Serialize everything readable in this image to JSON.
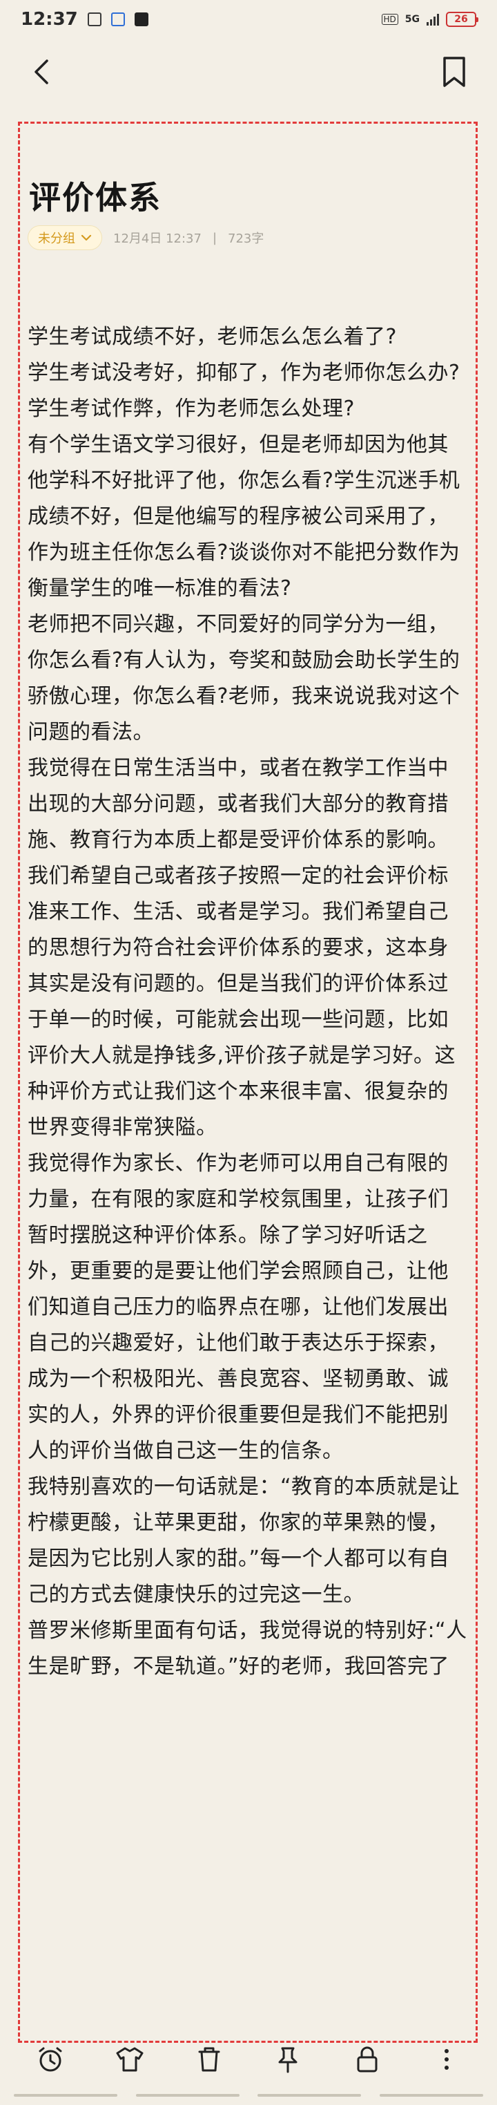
{
  "status_bar": {
    "time": "12:37",
    "network": "5G",
    "hd": "HD",
    "battery": "26",
    "battery_color": "#cc3333"
  },
  "nav": {
    "back_icon": "chevron-left-icon",
    "bookmark_icon": "bookmark-icon"
  },
  "note": {
    "title": "评价体系",
    "category": "未分组",
    "date": "12月4日 12:37",
    "separator": "|",
    "word_count": "723字",
    "paragraphs": [
      "学生考试成绩不好，老师怎么怎么着了?",
      "学生考试没考好，抑郁了，作为老师你怎么办?",
      "学生考试作弊，作为老师怎么处理?",
      "有个学生语文学习很好，但是老师却因为他其他学科不好批评了他，你怎么看?学生沉迷手机成绩不好，但是他编写的程序被公司采用了，作为班主任你怎么看?谈谈你对不能把分数作为衡量学生的唯一标准的看法?",
      "老师把不同兴趣，不同爱好的同学分为一组，你怎么看?有人认为，夸奖和鼓励会助长学生的骄傲心理，你怎么看?老师，我来说说我对这个问题的看法。",
      "我觉得在日常生活当中，或者在教学工作当中出现的大部分问题，或者我们大部分的教育措施、教育行为本质上都是受评价体系的影响。我们希望自己或者孩子按照一定的社会评价标准来工作、生活、或者是学习。我们希望自己的思想行为符合社会评价体系的要求，这本身其实是没有问题的。但是当我们的评价体系过于单一的时候，可能就会出现一些问题，比如评价大人就是挣钱多,评价孩子就是学习好。这种评价方式让我们这个本来很丰富、很复杂的世界变得非常狭隘。",
      "我觉得作为家长、作为老师可以用自己有限的力量，在有限的家庭和学校氛围里，让孩子们暂时摆脱这种评价体系。除了学习好听话之外，更重要的是要让他们学会照顾自己，让他们知道自己压力的临界点在哪，让他们发展出自己的兴趣爱好，让他们敢于表达乐于探索，成为一个积极阳光、善良宽容、坚韧勇敢、诚实的人，外界的评价很重要但是我们不能把别人的评价当做自己这一生的信条。",
      "我特别喜欢的一句话就是：“教育的本质就是让柠檬更酸，让苹果更甜，你家的苹果熟的慢，是因为它比别人家的甜。”每一个人都可以有自己的方式去健康快乐的过完这一生。",
      "普罗米修斯里面有句话，我觉得说的特别好:“人生是旷野，不是轨道。”好的老师，我回答完了"
    ]
  },
  "toolbar": {
    "items": [
      {
        "icon": "alarm-clock-icon"
      },
      {
        "icon": "tshirt-icon"
      },
      {
        "icon": "trash-icon"
      },
      {
        "icon": "pin-icon"
      },
      {
        "icon": "lock-icon"
      },
      {
        "icon": "more-icon"
      }
    ]
  },
  "colors": {
    "background": "#f3efe6",
    "highlight_border": "#e23b3b",
    "category_text": "#d49a1e",
    "meta_text": "#a7a39a"
  }
}
